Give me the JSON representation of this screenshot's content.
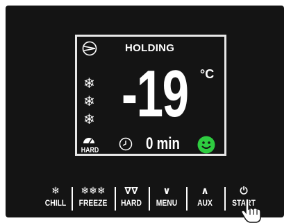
{
  "display": {
    "status": "HOLDING",
    "temperature": "-19",
    "unit": "°C",
    "hard_label": "HARD",
    "time_value": "0 min",
    "mood": "happy",
    "colors": {
      "background": "#141414",
      "foreground": "#ffffff",
      "smiley": "#2ecc40"
    },
    "icons": [
      "compressor-icon",
      "snowflake-icon",
      "hard-mode-icon",
      "clock-icon",
      "smiley-icon"
    ]
  },
  "buttons": [
    {
      "label": "CHILL",
      "icon": "❄"
    },
    {
      "label": "FREEZE",
      "icon": "❄❄❄"
    },
    {
      "label": "HARD",
      "icon": "∇∇"
    },
    {
      "label": "MENU",
      "icon": "∨"
    },
    {
      "label": "AUX",
      "icon": "∧"
    },
    {
      "label": "START",
      "icon": "⏻"
    }
  ]
}
